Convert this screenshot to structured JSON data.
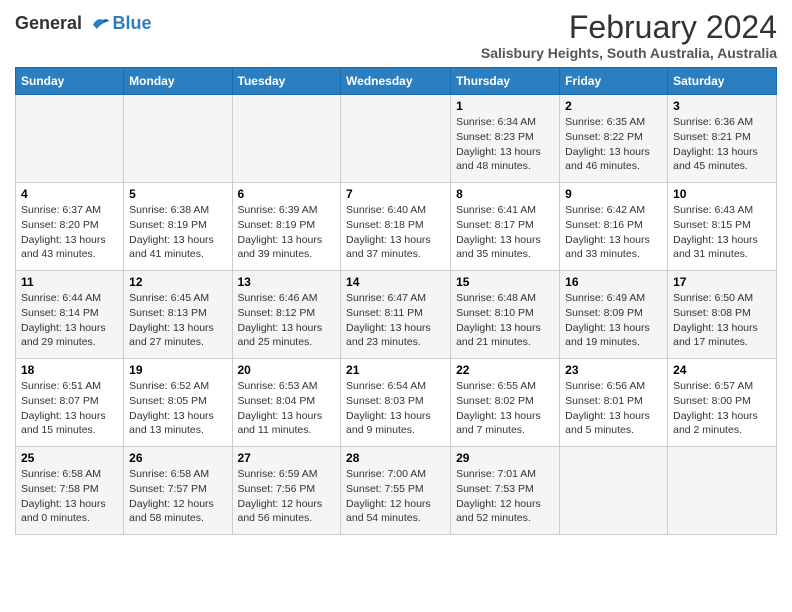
{
  "header": {
    "logo_general": "General",
    "logo_blue": "Blue",
    "month_year": "February 2024",
    "location": "Salisbury Heights, South Australia, Australia"
  },
  "days_of_week": [
    "Sunday",
    "Monday",
    "Tuesday",
    "Wednesday",
    "Thursday",
    "Friday",
    "Saturday"
  ],
  "weeks": [
    [
      {
        "day": "",
        "info": ""
      },
      {
        "day": "",
        "info": ""
      },
      {
        "day": "",
        "info": ""
      },
      {
        "day": "",
        "info": ""
      },
      {
        "day": "1",
        "info": "Sunrise: 6:34 AM\nSunset: 8:23 PM\nDaylight: 13 hours and 48 minutes."
      },
      {
        "day": "2",
        "info": "Sunrise: 6:35 AM\nSunset: 8:22 PM\nDaylight: 13 hours and 46 minutes."
      },
      {
        "day": "3",
        "info": "Sunrise: 6:36 AM\nSunset: 8:21 PM\nDaylight: 13 hours and 45 minutes."
      }
    ],
    [
      {
        "day": "4",
        "info": "Sunrise: 6:37 AM\nSunset: 8:20 PM\nDaylight: 13 hours and 43 minutes."
      },
      {
        "day": "5",
        "info": "Sunrise: 6:38 AM\nSunset: 8:19 PM\nDaylight: 13 hours and 41 minutes."
      },
      {
        "day": "6",
        "info": "Sunrise: 6:39 AM\nSunset: 8:19 PM\nDaylight: 13 hours and 39 minutes."
      },
      {
        "day": "7",
        "info": "Sunrise: 6:40 AM\nSunset: 8:18 PM\nDaylight: 13 hours and 37 minutes."
      },
      {
        "day": "8",
        "info": "Sunrise: 6:41 AM\nSunset: 8:17 PM\nDaylight: 13 hours and 35 minutes."
      },
      {
        "day": "9",
        "info": "Sunrise: 6:42 AM\nSunset: 8:16 PM\nDaylight: 13 hours and 33 minutes."
      },
      {
        "day": "10",
        "info": "Sunrise: 6:43 AM\nSunset: 8:15 PM\nDaylight: 13 hours and 31 minutes."
      }
    ],
    [
      {
        "day": "11",
        "info": "Sunrise: 6:44 AM\nSunset: 8:14 PM\nDaylight: 13 hours and 29 minutes."
      },
      {
        "day": "12",
        "info": "Sunrise: 6:45 AM\nSunset: 8:13 PM\nDaylight: 13 hours and 27 minutes."
      },
      {
        "day": "13",
        "info": "Sunrise: 6:46 AM\nSunset: 8:12 PM\nDaylight: 13 hours and 25 minutes."
      },
      {
        "day": "14",
        "info": "Sunrise: 6:47 AM\nSunset: 8:11 PM\nDaylight: 13 hours and 23 minutes."
      },
      {
        "day": "15",
        "info": "Sunrise: 6:48 AM\nSunset: 8:10 PM\nDaylight: 13 hours and 21 minutes."
      },
      {
        "day": "16",
        "info": "Sunrise: 6:49 AM\nSunset: 8:09 PM\nDaylight: 13 hours and 19 minutes."
      },
      {
        "day": "17",
        "info": "Sunrise: 6:50 AM\nSunset: 8:08 PM\nDaylight: 13 hours and 17 minutes."
      }
    ],
    [
      {
        "day": "18",
        "info": "Sunrise: 6:51 AM\nSunset: 8:07 PM\nDaylight: 13 hours and 15 minutes."
      },
      {
        "day": "19",
        "info": "Sunrise: 6:52 AM\nSunset: 8:05 PM\nDaylight: 13 hours and 13 minutes."
      },
      {
        "day": "20",
        "info": "Sunrise: 6:53 AM\nSunset: 8:04 PM\nDaylight: 13 hours and 11 minutes."
      },
      {
        "day": "21",
        "info": "Sunrise: 6:54 AM\nSunset: 8:03 PM\nDaylight: 13 hours and 9 minutes."
      },
      {
        "day": "22",
        "info": "Sunrise: 6:55 AM\nSunset: 8:02 PM\nDaylight: 13 hours and 7 minutes."
      },
      {
        "day": "23",
        "info": "Sunrise: 6:56 AM\nSunset: 8:01 PM\nDaylight: 13 hours and 5 minutes."
      },
      {
        "day": "24",
        "info": "Sunrise: 6:57 AM\nSunset: 8:00 PM\nDaylight: 13 hours and 2 minutes."
      }
    ],
    [
      {
        "day": "25",
        "info": "Sunrise: 6:58 AM\nSunset: 7:58 PM\nDaylight: 13 hours and 0 minutes."
      },
      {
        "day": "26",
        "info": "Sunrise: 6:58 AM\nSunset: 7:57 PM\nDaylight: 12 hours and 58 minutes."
      },
      {
        "day": "27",
        "info": "Sunrise: 6:59 AM\nSunset: 7:56 PM\nDaylight: 12 hours and 56 minutes."
      },
      {
        "day": "28",
        "info": "Sunrise: 7:00 AM\nSunset: 7:55 PM\nDaylight: 12 hours and 54 minutes."
      },
      {
        "day": "29",
        "info": "Sunrise: 7:01 AM\nSunset: 7:53 PM\nDaylight: 12 hours and 52 minutes."
      },
      {
        "day": "",
        "info": ""
      },
      {
        "day": "",
        "info": ""
      }
    ]
  ]
}
